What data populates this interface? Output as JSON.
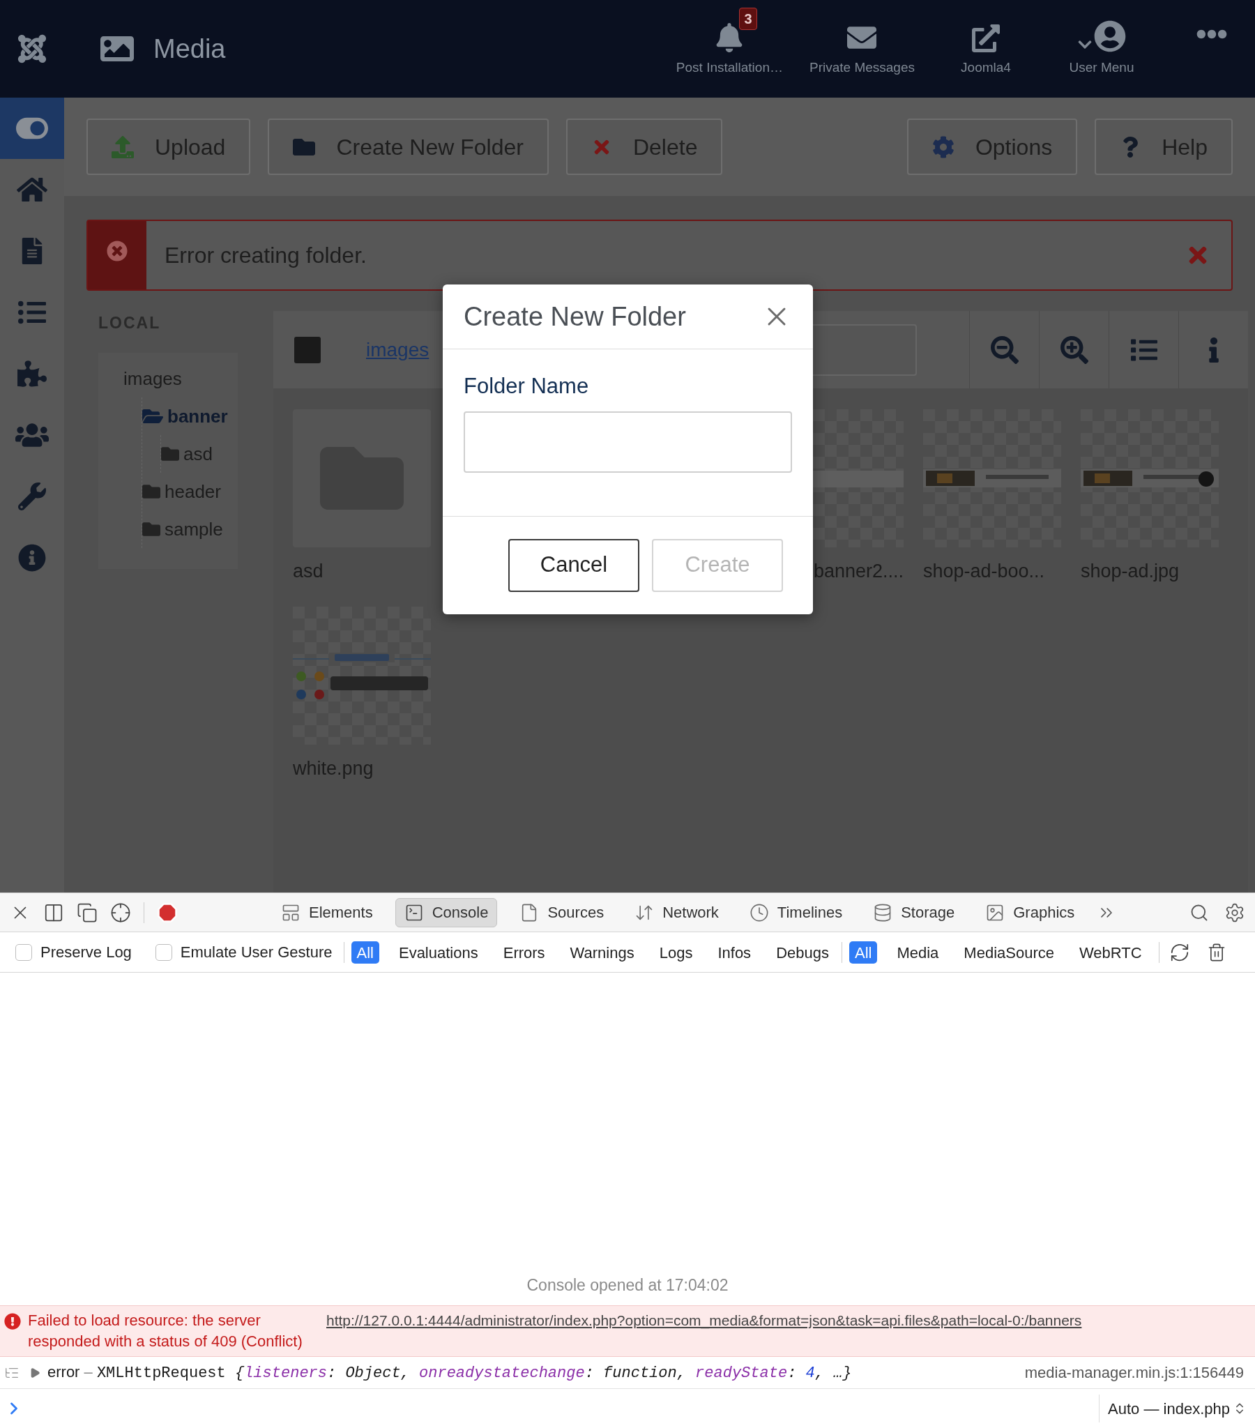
{
  "header": {
    "title": "Media",
    "items": [
      {
        "kind": "bell",
        "label": "Post Installation…",
        "badge": "3"
      },
      {
        "kind": "mail",
        "label": "Private Messages"
      },
      {
        "kind": "external",
        "label": "Joomla4"
      },
      {
        "kind": "user",
        "label": "User Menu"
      }
    ]
  },
  "sidebar": {
    "items": [
      {
        "kind": "toggle",
        "selected": true
      },
      {
        "kind": "home",
        "selected": false
      },
      {
        "kind": "file",
        "selected": false
      },
      {
        "kind": "list",
        "selected": false
      },
      {
        "kind": "puzzle",
        "selected": false
      },
      {
        "kind": "users",
        "selected": false
      },
      {
        "kind": "wrench",
        "selected": false
      },
      {
        "kind": "info",
        "selected": false
      }
    ]
  },
  "toolbar": {
    "buttons": [
      {
        "kind": "upload",
        "label": "Upload"
      },
      {
        "kind": "folder",
        "label": "Create New Folder"
      },
      {
        "kind": "delete",
        "label": "Delete"
      },
      {
        "kind": "options",
        "label": "Options"
      },
      {
        "kind": "help",
        "label": "Help"
      }
    ]
  },
  "alert": {
    "message": "Error creating folder."
  },
  "local": {
    "heading": "LOCAL",
    "tree": [
      {
        "label": "images",
        "selected": false,
        "children": [
          {
            "label": "banner",
            "selected": true,
            "children": [
              {
                "label": "asd",
                "selected": false
              }
            ]
          },
          {
            "label": "header",
            "selected": false
          },
          {
            "label": "sample",
            "selected": false
          }
        ]
      }
    ]
  },
  "browser": {
    "select_all": {
      "checked": false
    },
    "breadcrumb": "images",
    "files": [
      {
        "kind": "folder",
        "name": "asd"
      },
      {
        "kind": "picture",
        "name": "banner2...."
      },
      {
        "kind": "picture",
        "name": "shop-ad-boo..."
      },
      {
        "kind": "picture",
        "name": "shop-ad.jpg"
      },
      {
        "kind": "picture",
        "name": "white.png"
      }
    ]
  },
  "modal": {
    "title": "Create New Folder",
    "field_label": "Folder Name",
    "buttons": [
      {
        "label": "Cancel",
        "disabled": false
      },
      {
        "label": "Create",
        "disabled": true
      }
    ]
  },
  "devtools": {
    "tabs": [
      {
        "kind": "elements",
        "label": "Elements",
        "selected": false
      },
      {
        "kind": "console",
        "label": "Console",
        "selected": true
      },
      {
        "kind": "sources",
        "label": "Sources",
        "selected": false
      },
      {
        "kind": "network",
        "label": "Network",
        "selected": false
      },
      {
        "kind": "timelines",
        "label": "Timelines",
        "selected": false
      },
      {
        "kind": "storage",
        "label": "Storage",
        "selected": false
      },
      {
        "kind": "graphics",
        "label": "Graphics",
        "selected": false
      }
    ],
    "checkboxes": [
      {
        "label": "Preserve Log",
        "checked": false
      },
      {
        "label": "Emulate User Gesture",
        "checked": false
      }
    ],
    "levels": [
      {
        "label": "All",
        "selected": true
      },
      {
        "label": "Evaluations",
        "selected": false
      },
      {
        "label": "Errors",
        "selected": false
      },
      {
        "label": "Warnings",
        "selected": false
      },
      {
        "label": "Logs",
        "selected": false
      },
      {
        "label": "Infos",
        "selected": false
      },
      {
        "label": "Debugs",
        "selected": false
      }
    ],
    "sources": [
      {
        "label": "All",
        "selected": true
      },
      {
        "label": "Media",
        "selected": false
      },
      {
        "label": "MediaSource",
        "selected": false
      },
      {
        "label": "WebRTC",
        "selected": false
      }
    ],
    "console": {
      "opened": "Console opened at 17:04:02",
      "error": {
        "text": "Failed to load resource: the server responded with a status of 409 (Conflict)",
        "link": "http://127.0.0.1:4444/administrator/index.php?option=com_media&format=json&task=api.files&path=local-0:/banners"
      },
      "log": {
        "tokens": [
          {
            "kind": "word",
            "text": "error"
          },
          {
            "kind": "dash",
            "text": " – "
          },
          {
            "kind": "plain",
            "text": "XMLHttpRequest "
          },
          {
            "kind": "punct",
            "text": "{"
          },
          {
            "kind": "key",
            "text": "listeners"
          },
          {
            "kind": "punct",
            "text": ": Object, "
          },
          {
            "kind": "key",
            "text": "onreadystatechange"
          },
          {
            "kind": "punct",
            "text": ": function, "
          },
          {
            "kind": "key",
            "text": "readyState"
          },
          {
            "kind": "punct",
            "text": ": "
          },
          {
            "kind": "number",
            "text": "4"
          },
          {
            "kind": "punct",
            "text": ", …}"
          }
        ],
        "source": "media-manager.min.js:1:156449"
      },
      "context": "Auto — index.php"
    }
  }
}
